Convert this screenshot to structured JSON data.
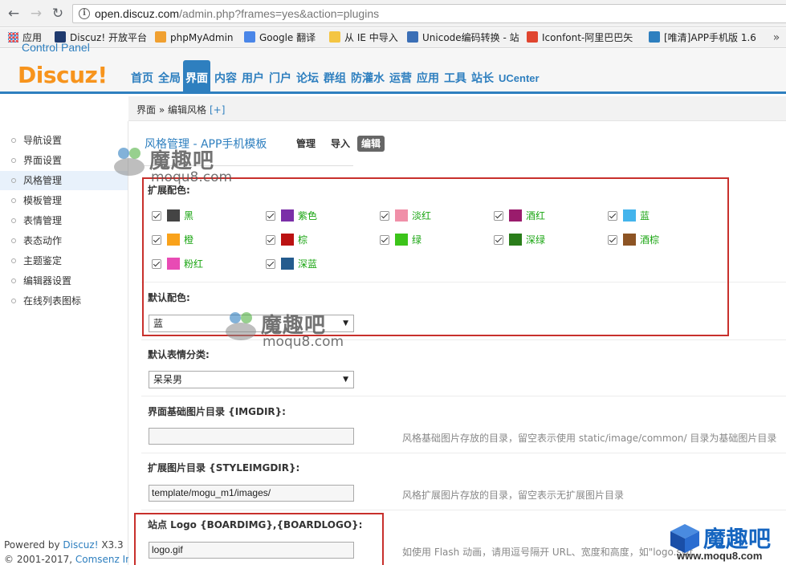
{
  "browser": {
    "url_host": "open.discuz.com",
    "url_path": "/admin.php?frames=yes&action=plugins",
    "bookmarks": [
      {
        "label": "应用",
        "color": "apps"
      },
      {
        "label": "Discuz! 开放平台",
        "color": "#1f3a6e"
      },
      {
        "label": "phpMyAdmin",
        "color": "#f0a030"
      },
      {
        "label": "Google 翻译",
        "color": "#4a86e8"
      },
      {
        "label": "从 IE 中导入",
        "color": "#f4c542"
      },
      {
        "label": "Unicode编码转换 - 站",
        "color": "#3b6fb6"
      },
      {
        "label": "Iconfont-阿里巴巴矢",
        "color": "#e0452f"
      },
      {
        "label": "[唯清]APP手机版 1.6",
        "color": "#2e7fbf"
      }
    ]
  },
  "header": {
    "logo": "Discuz!",
    "logo_sub": "Control Panel",
    "nav": [
      "首页",
      "全局",
      "界面",
      "内容",
      "用户",
      "门户",
      "论坛",
      "群组",
      "防灌水",
      "运营",
      "应用",
      "工具",
      "站长",
      "UCenter"
    ],
    "active_nav": "界面"
  },
  "breadcrumb": {
    "path": "界面 » 编辑风格",
    "add": "[+]"
  },
  "sidebar": {
    "items": [
      "导航设置",
      "界面设置",
      "风格管理",
      "模板管理",
      "表情管理",
      "表态动作",
      "主题鉴定",
      "编辑器设置",
      "在线列表图标"
    ],
    "active": "风格管理",
    "powered_prefix": "Powered by ",
    "powered_brand": "Discuz!",
    "powered_version": " X3.3",
    "copyright_prefix": "© 2001-2017, ",
    "copyright_brand": "Comsenz Inc."
  },
  "main": {
    "title": "风格管理 - APP手机模板",
    "tabs": [
      "管理",
      "导入",
      "编辑"
    ],
    "active_tab": "编辑",
    "ext_colors_label": "扩展配色:",
    "ext_colors": [
      {
        "name": "黑",
        "color": "#444444",
        "checked": true
      },
      {
        "name": "紫色",
        "color": "#7b2fa8",
        "checked": true
      },
      {
        "name": "淡红",
        "color": "#f08fa8",
        "checked": true
      },
      {
        "name": "酒红",
        "color": "#9a1c6c",
        "checked": true
      },
      {
        "name": "蓝",
        "color": "#44b4ec",
        "checked": true
      },
      {
        "name": "橙",
        "color": "#f9a21b",
        "checked": true
      },
      {
        "name": "棕",
        "color": "#bb1212",
        "checked": true
      },
      {
        "name": "绿",
        "color": "#3cc41a",
        "checked": true
      },
      {
        "name": "深绿",
        "color": "#2a7d1a",
        "checked": true
      },
      {
        "name": "酒棕",
        "color": "#8d5424",
        "checked": true
      },
      {
        "name": "粉红",
        "color": "#e84bb4",
        "checked": true
      },
      {
        "name": "深蓝",
        "color": "#245b8e",
        "checked": true
      }
    ],
    "default_color_label": "默认配色:",
    "default_color": "蓝",
    "default_smiley_label": "默认表情分类:",
    "default_smiley": "呆呆男",
    "imgdir_label": "界面基础图片目录 {IMGDIR}:",
    "imgdir_value": "",
    "imgdir_hint": "风格基础图片存放的目录，留空表示使用 static/image/common/ 目录为基础图片目录",
    "styleimgdir_label": "扩展图片目录 {STYLEIMGDIR}:",
    "styleimgdir_value": "template/mogu_m1/images/",
    "styleimgdir_hint": "风格扩展图片存放的目录，留空表示无扩展图片目录",
    "boardimg_label": "站点 Logo {BOARDIMG},{BOARDLOGO}:",
    "boardimg_value": "logo.gif",
    "boardimg_hint": "如使用 Flash 动画，请用逗号隔开 URL、宽度和高度，如\"logo.swf"
  },
  "watermark": {
    "cn": "魔趣吧",
    "en": "moqu8.com"
  },
  "corner_logo": {
    "cn": "魔趣吧",
    "en": "www.moqu8.com"
  },
  "colors": {
    "brand_blue": "#2e7fbf",
    "logo_orange": "#f7941d",
    "highlight_red": "#c8302c",
    "option_green": "#1aa512"
  }
}
